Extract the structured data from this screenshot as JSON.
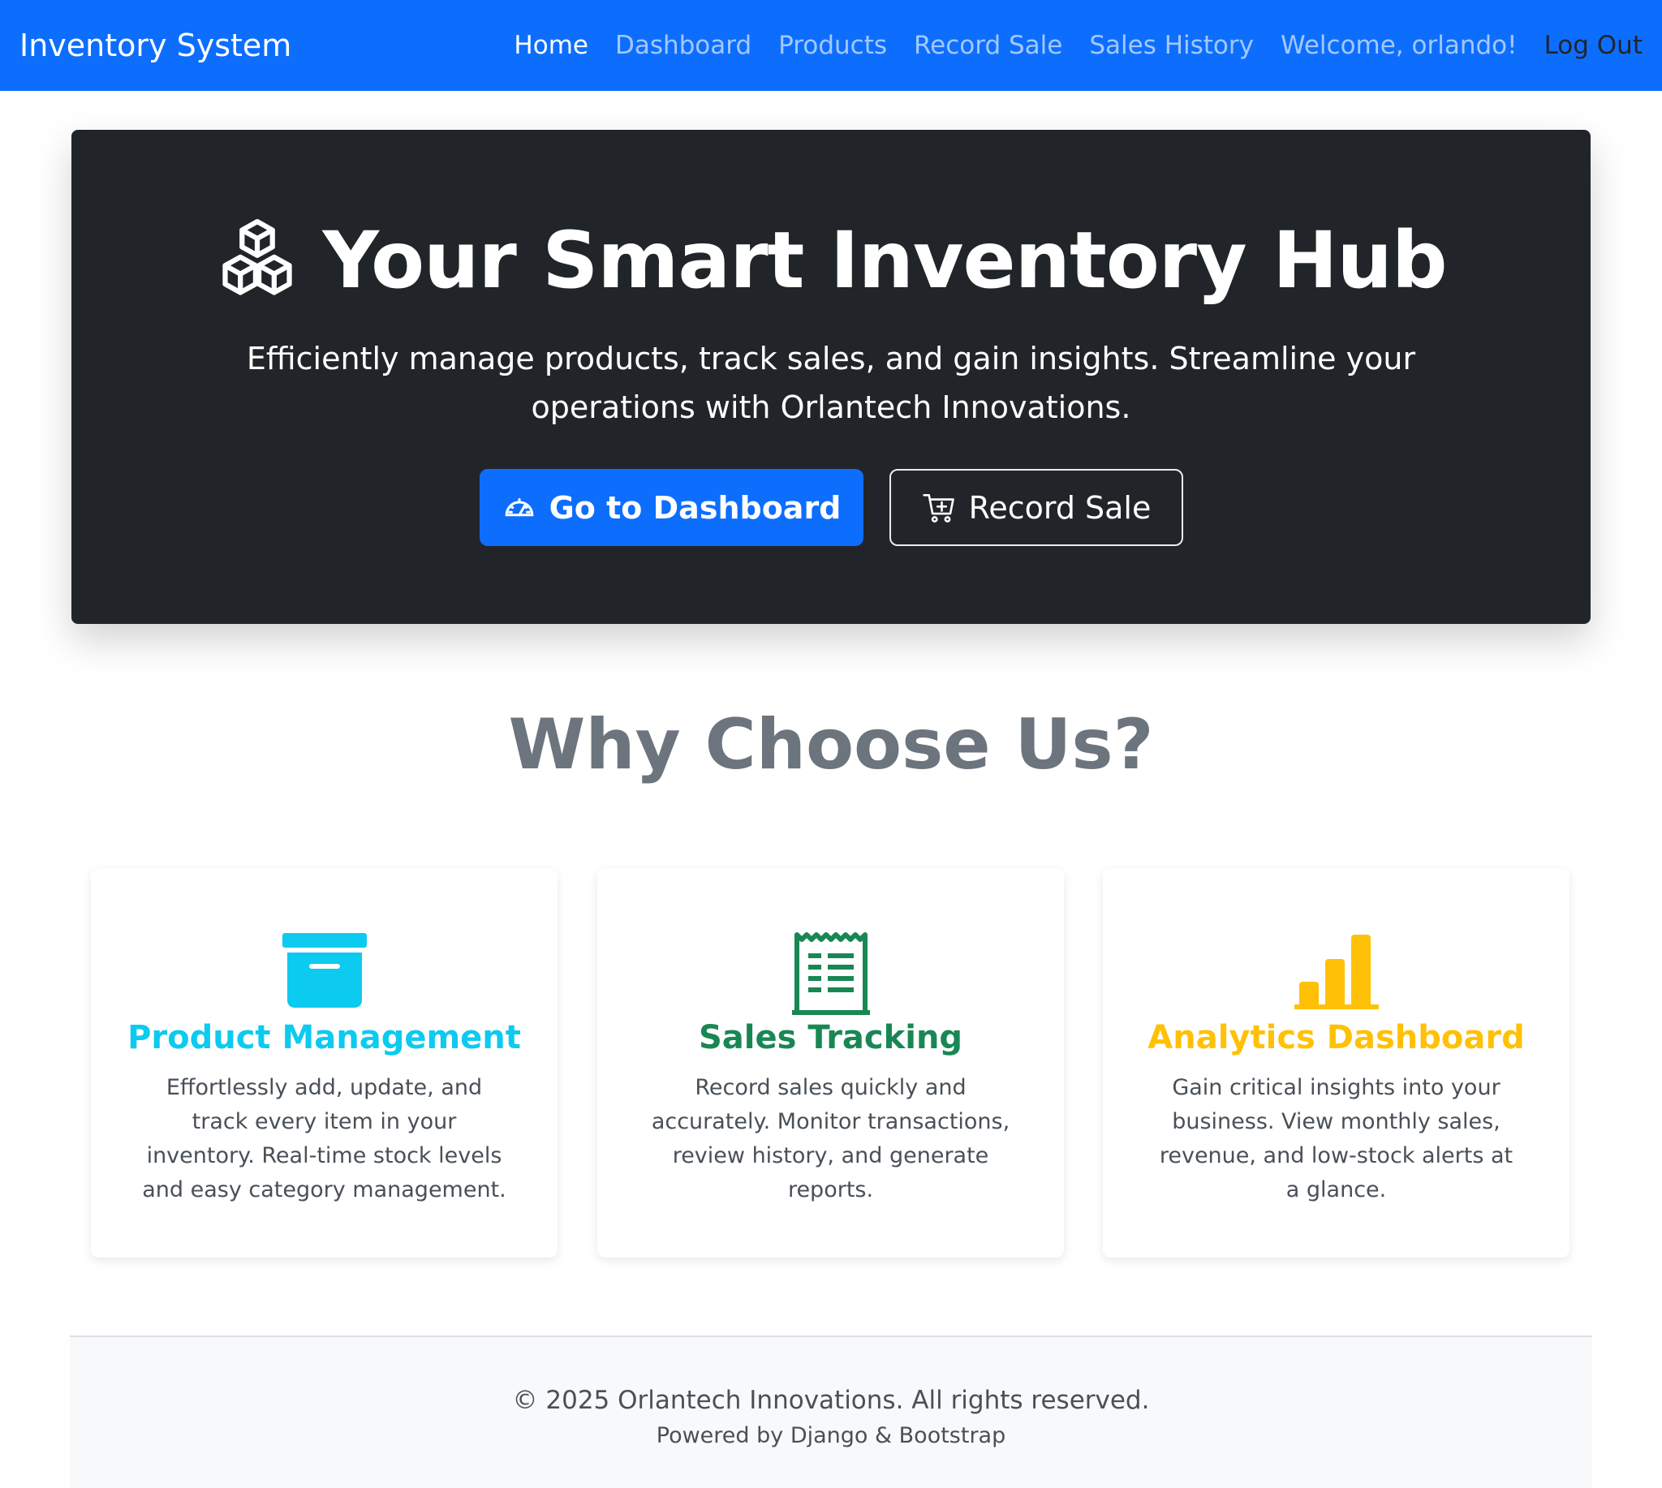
{
  "navbar": {
    "brand": "Inventory System",
    "links": [
      {
        "label": "Home"
      },
      {
        "label": "Dashboard"
      },
      {
        "label": "Products"
      },
      {
        "label": "Record Sale"
      },
      {
        "label": "Sales History"
      },
      {
        "label": "Welcome, orlando!"
      },
      {
        "label": "Log Out"
      }
    ]
  },
  "hero": {
    "icon": "boxes-icon",
    "title": "Your Smart Inventory Hub",
    "subtitle": "Efficiently manage products, track sales, and gain insights. Streamline your operations with Orlantech Innovations.",
    "primary_button": {
      "label": "Go to Dashboard",
      "icon": "speedometer-icon"
    },
    "secondary_button": {
      "label": "Record Sale",
      "icon": "cart-plus-icon"
    }
  },
  "why": {
    "title": "Why Choose Us?",
    "cards": [
      {
        "icon": "archive-box-icon",
        "title": "Product Management",
        "text": "Effortlessly add, update, and track every item in your inventory. Real-time stock levels and easy category management.",
        "color": "#0dcaf0"
      },
      {
        "icon": "receipt-icon",
        "title": "Sales Tracking",
        "text": "Record sales quickly and accurately. Monitor transactions, review history, and generate reports.",
        "color": "#198754"
      },
      {
        "icon": "bar-chart-icon",
        "title": "Analytics Dashboard",
        "text": "Gain critical insights into your business. View monthly sales, revenue, and low-stock alerts at a glance.",
        "color": "#ffc107"
      }
    ]
  },
  "footer": {
    "copyright": "© 2025 Orlantech Innovations. All rights reserved.",
    "powered": "Powered by Django & Bootstrap"
  },
  "colors": {
    "primary": "#0d6efd",
    "dark": "#212529",
    "muted": "#6c757d",
    "info": "#0dcaf0",
    "success": "#198754",
    "warning": "#ffc107"
  }
}
